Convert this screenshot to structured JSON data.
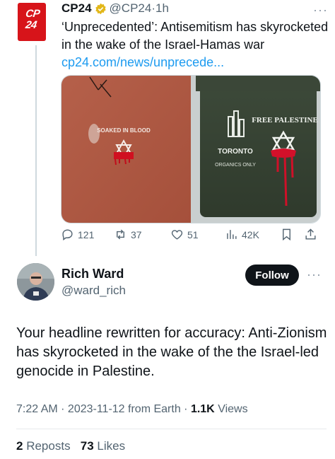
{
  "tweet1": {
    "logo_text": "CP24",
    "name": "CP24",
    "handle": "@CP24",
    "dot": " · ",
    "time": "1h",
    "text": "‘Unprecedented’: Antisemitism has skyrocketed in the wake of the Israel-Hamas war ",
    "link": "cp24.com/news/unprecede...",
    "media": {
      "left_text": "SOAKED IN BLOOD",
      "bin_logo": "TORONTO",
      "bin_text": "ORGANICS ONLY",
      "right_text": "FREE PALESTINE"
    },
    "actions": {
      "replies": "121",
      "reposts": "37",
      "likes": "51",
      "views": "42K"
    },
    "more": "···"
  },
  "tweet2": {
    "name": "Rich Ward",
    "handle": "@ward_rich",
    "follow_label": "Follow",
    "more": "···",
    "text": "Your headline rewritten for accuracy: Anti-Zionism has skyrocketed in the wake of the the Israel-led genocide in Palestine.",
    "time": "7:22 AM",
    "date": "2023-11-12",
    "source": "from Earth",
    "views_count": "1.1K",
    "views_label": "Views",
    "reposts_count": "2",
    "reposts_label": "Reposts",
    "likes_count": "73",
    "likes_label": "Likes"
  },
  "colors": {
    "brand_red": "#d7141a",
    "link": "#1d9bf0",
    "muted": "#536471",
    "verified_gold": "#e2b719"
  }
}
